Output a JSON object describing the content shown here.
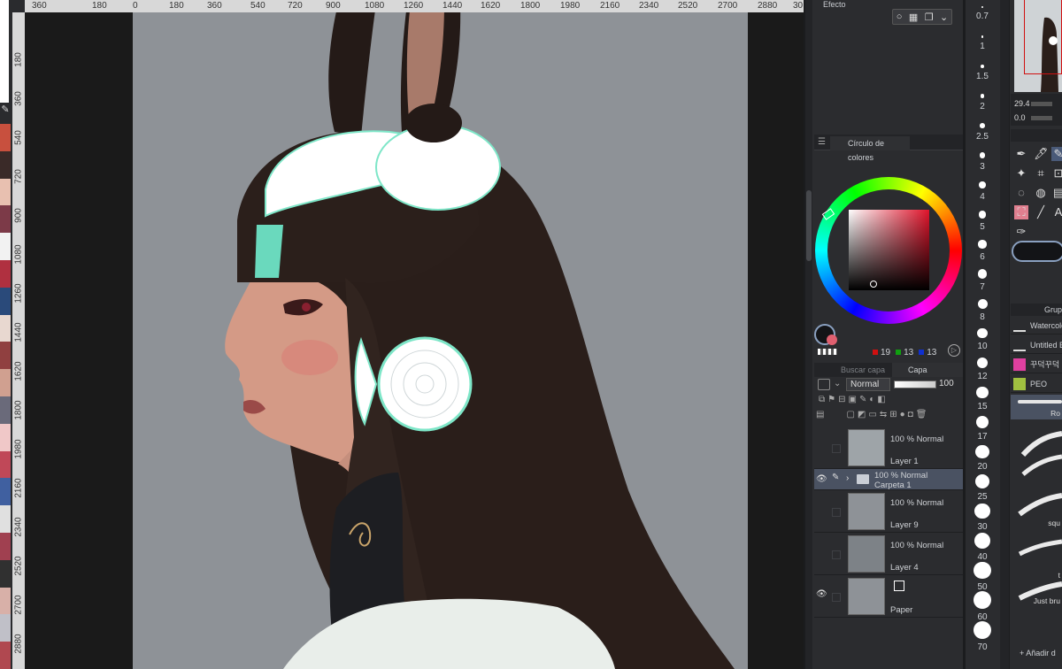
{
  "ruler_top": [
    "360",
    "180",
    "0",
    "180",
    "360",
    "540",
    "720",
    "900",
    "1080",
    "1260",
    "1440",
    "1620",
    "1800",
    "1980",
    "2160",
    "2340",
    "2520",
    "2700",
    "2880",
    "30"
  ],
  "ruler_left": [
    "180",
    "360",
    "540",
    "720",
    "900",
    "1080",
    "1260",
    "1440",
    "1620",
    "1800",
    "1980",
    "2160",
    "2340",
    "2520",
    "2700",
    "2880"
  ],
  "effect_panel": {
    "title": "Efecto"
  },
  "color_circle": {
    "title": "Círculo de colores",
    "r": "19",
    "g": "13",
    "b": "13"
  },
  "layer_panel": {
    "tab_search": "Buscar capa",
    "tab_layer": "Capa",
    "blend_mode": "Normal",
    "opacity": "100",
    "layers": [
      {
        "mode": "100 % Normal",
        "name": "Layer 1",
        "visible": false
      },
      {
        "mode": "100 % Normal",
        "name": "Carpeta 1",
        "visible": true,
        "selected": true
      },
      {
        "mode": "100 % Normal",
        "name": "Layer 9",
        "visible": false
      },
      {
        "mode": "100 % Normal",
        "name": "Layer 4",
        "visible": false
      },
      {
        "mode": "",
        "name": "Paper",
        "visible": true
      }
    ]
  },
  "brush_sizes": [
    "0.7",
    "1",
    "1.5",
    "2",
    "2.5",
    "3",
    "4",
    "5",
    "6",
    "7",
    "8",
    "10",
    "12",
    "15",
    "17",
    "20",
    "25",
    "30",
    "40",
    "50",
    "60",
    "70"
  ],
  "navigator": {
    "zoom": "29.4",
    "rotation": "0.0"
  },
  "subtool_group": {
    "header": "Grupo",
    "items": [
      "Watercolor",
      "Untitled B",
      "꾸덕꾸덕",
      "PEO"
    ]
  },
  "brush_strokes": [
    "Ro",
    "squ",
    "t",
    "Just bru"
  ],
  "add_brush": "Añadir d"
}
